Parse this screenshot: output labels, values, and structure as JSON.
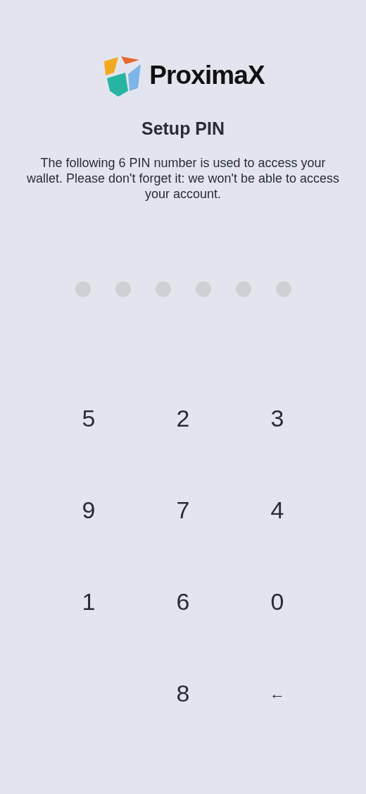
{
  "logo": {
    "wordmark": "ProximaX"
  },
  "title": "Setup PIN",
  "description": "The following 6 PIN number is used to access your wallet. Please don't forget it: we won't be able to access your account.",
  "pin_dots": [
    {
      "filled": false
    },
    {
      "filled": false
    },
    {
      "filled": false
    },
    {
      "filled": false
    },
    {
      "filled": false
    },
    {
      "filled": false
    }
  ],
  "keypad": [
    {
      "kind": "digit",
      "label": "5"
    },
    {
      "kind": "digit",
      "label": "2"
    },
    {
      "kind": "digit",
      "label": "3"
    },
    {
      "kind": "digit",
      "label": "9"
    },
    {
      "kind": "digit",
      "label": "7"
    },
    {
      "kind": "digit",
      "label": "4"
    },
    {
      "kind": "digit",
      "label": "1"
    },
    {
      "kind": "digit",
      "label": "6"
    },
    {
      "kind": "digit",
      "label": "0"
    },
    {
      "kind": "blank"
    },
    {
      "kind": "digit",
      "label": "8"
    },
    {
      "kind": "backspace",
      "label": "←"
    }
  ]
}
